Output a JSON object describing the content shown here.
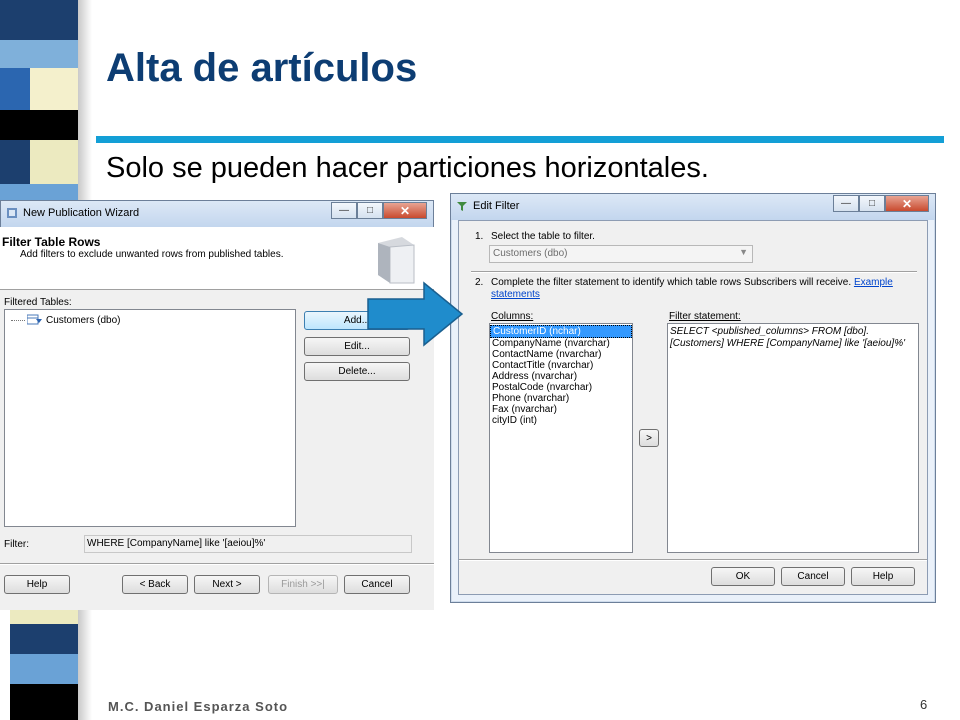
{
  "slide": {
    "title": "Alta de artículos",
    "bullet": "Solo se pueden hacer particiones horizontales.",
    "author": "M.C. Daniel Esparza Soto",
    "page_number": "6"
  },
  "wizard": {
    "title": "New Publication Wizard",
    "heading": "Filter Table Rows",
    "subheading": "Add filters to exclude unwanted rows from published tables.",
    "filtered_tables_label": "Filtered Tables:",
    "tree_item": "Customers (dbo)",
    "add_button": "Add...",
    "edit_button": "Edit...",
    "delete_button": "Delete...",
    "filter_label": "Filter:",
    "filter_value": "WHERE [CompanyName] like '[aeiou]%'",
    "help_button": "Help",
    "back_button": "< Back",
    "next_button": "Next >",
    "finish_button": "Finish >>|",
    "cancel_button": "Cancel"
  },
  "edit_filter": {
    "title": "Edit Filter",
    "step1": "1.",
    "step1_text": "Select the table to filter.",
    "table_select_value": "Customers (dbo)",
    "step2": "2.",
    "step2_text": "Complete the filter statement to identify which table rows Subscribers will receive.",
    "example_link": "Example",
    "statements_link": "statements",
    "columns_label": "Columns:",
    "columns": [
      "CustomerID (nchar)",
      "CompanyName (nvarchar)",
      "ContactName (nvarchar)",
      "ContactTitle (nvarchar)",
      "Address (nvarchar)",
      "PostalCode (nvarchar)",
      "Phone (nvarchar)",
      "Fax (nvarchar)",
      "cityID (int)"
    ],
    "selected_column": "CustomerID (nchar)",
    "filter_statement_label": "Filter statement:",
    "filter_line1": "SELECT <published_columns> FROM [dbo].",
    "filter_line2": "[Customers] WHERE [CompanyName] like '[aeiou]%'",
    "insert_button": ">",
    "ok_button": "OK",
    "cancel_button": "Cancel",
    "help_button": "Help"
  },
  "colors": {
    "title": "#0d3d73",
    "rule": "#139fd6",
    "arrow": "#1f8ccc"
  }
}
